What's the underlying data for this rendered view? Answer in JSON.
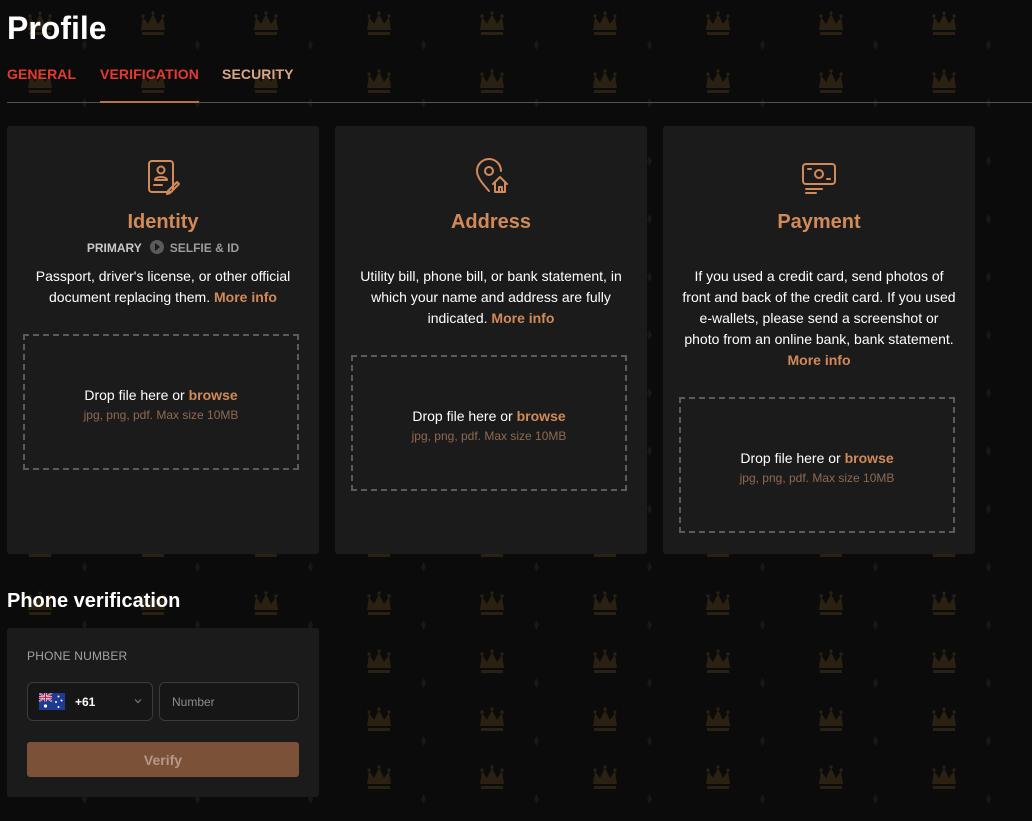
{
  "page": {
    "title": "Profile"
  },
  "tabs": [
    {
      "label": "GENERAL"
    },
    {
      "label": "VERIFICATION",
      "active": true
    },
    {
      "label": "SECURITY"
    }
  ],
  "cards": {
    "identity": {
      "icon": "id-document-icon",
      "title": "Identity",
      "step_primary": "PRIMARY",
      "step_secondary": "SELFIE & ID",
      "description": "Passport, driver's license, or other official document replacing them.",
      "more_info": "More info",
      "drop_text": "Drop file here or",
      "browse": "browse",
      "hint": "jpg, png, pdf. Max size 10MB"
    },
    "address": {
      "icon": "location-home-icon",
      "title": "Address",
      "description": "Utility bill, phone bill, or bank statement, in which your name and address are fully indicated.",
      "more_info": "More info",
      "drop_text": "Drop file here or",
      "browse": "browse",
      "hint": "jpg, png, pdf. Max size 10MB"
    },
    "payment": {
      "icon": "payment-card-icon",
      "title": "Payment",
      "description": "If you used a credit card, send photos of front and back of the credit card. If you used e-wallets, please send a screenshot or photo from an online bank, bank statement.",
      "more_info": "More info",
      "drop_text": "Drop file here or",
      "browse": "browse",
      "hint": "jpg, png, pdf. Max size 10MB"
    }
  },
  "phone": {
    "heading": "Phone verification",
    "label": "PHONE NUMBER",
    "country_flag": "australia-flag-icon",
    "dial_code": "+61",
    "number_placeholder": "Number",
    "number_value": "",
    "verify_label": "Verify"
  },
  "colors": {
    "background": "#0b0b0b",
    "card": "#1b1b1b",
    "accent": "#d18a58",
    "tab_active": "#e53a30",
    "button": "#7b5138"
  }
}
